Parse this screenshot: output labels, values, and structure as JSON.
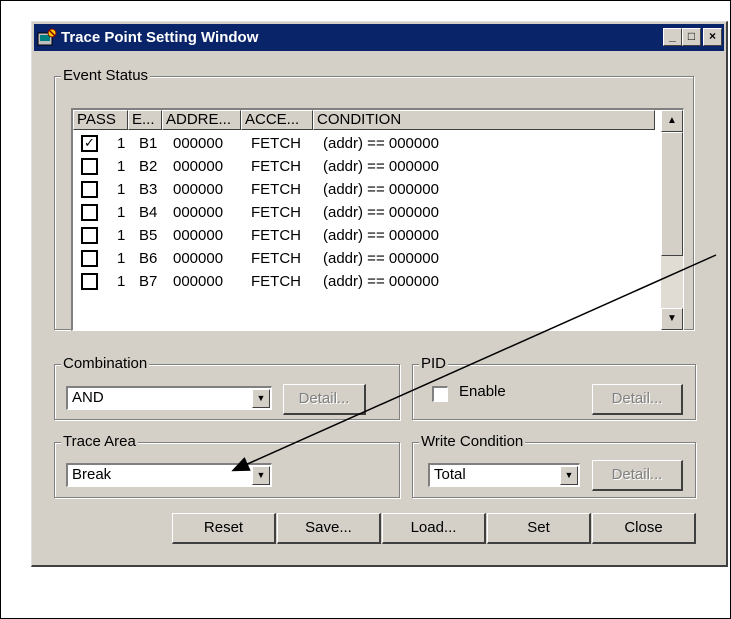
{
  "window": {
    "title": "Trace Point Setting Window"
  },
  "title_buttons": {
    "minimize": "_",
    "maximize": "□",
    "close": "×"
  },
  "event_status": {
    "label": "Event Status",
    "columns": [
      "PASS",
      "E...",
      "ADDRE...",
      "ACCE...",
      "CONDITION"
    ],
    "rows": [
      {
        "checked": true,
        "pass": "1",
        "event": "B1",
        "address": "000000",
        "access": "FETCH",
        "condition": "(addr) == 000000"
      },
      {
        "checked": false,
        "pass": "1",
        "event": "B2",
        "address": "000000",
        "access": "FETCH",
        "condition": "(addr) == 000000"
      },
      {
        "checked": false,
        "pass": "1",
        "event": "B3",
        "address": "000000",
        "access": "FETCH",
        "condition": "(addr) == 000000"
      },
      {
        "checked": false,
        "pass": "1",
        "event": "B4",
        "address": "000000",
        "access": "FETCH",
        "condition": "(addr) == 000000"
      },
      {
        "checked": false,
        "pass": "1",
        "event": "B5",
        "address": "000000",
        "access": "FETCH",
        "condition": "(addr) == 000000"
      },
      {
        "checked": false,
        "pass": "1",
        "event": "B6",
        "address": "000000",
        "access": "FETCH",
        "condition": "(addr) == 000000"
      },
      {
        "checked": false,
        "pass": "1",
        "event": "B7",
        "address": "000000",
        "access": "FETCH",
        "condition": "(addr) == 000000"
      }
    ],
    "check_mark": "✓"
  },
  "combination": {
    "label": "Combination",
    "value": "AND",
    "detail_label": "Detail..."
  },
  "pid": {
    "label": "PID",
    "enable_label": "Enable",
    "enabled": false,
    "detail_label": "Detail..."
  },
  "trace_area": {
    "label": "Trace Area",
    "value": "Break"
  },
  "write_condition": {
    "label": "Write Condition",
    "value": "Total",
    "detail_label": "Detail..."
  },
  "buttons": {
    "reset": "Reset",
    "save": "Save...",
    "load": "Load...",
    "set": "Set",
    "close": "Close"
  },
  "icons": {
    "scroll_up": "▲",
    "scroll_down": "▼",
    "dropdown": "▼"
  }
}
